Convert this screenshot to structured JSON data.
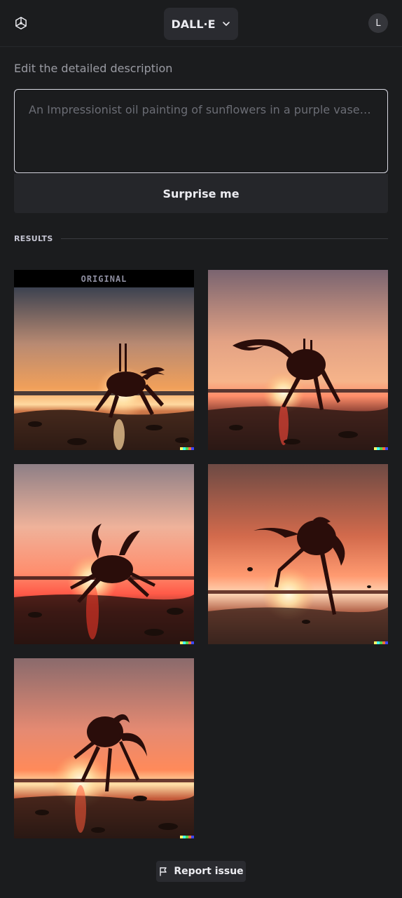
{
  "header": {
    "model_label": "DALL·E",
    "avatar_initial": "L"
  },
  "editor": {
    "section_label": "Edit the detailed description",
    "prompt_placeholder": "An Impressionist oil painting of sunflowers in a purple vase…",
    "surprise_label": "Surprise me"
  },
  "results": {
    "label": "RESULTS",
    "original_tag": "ORIGINAL",
    "images": [
      {
        "name": "result-image-original",
        "subject": "crab silhouette at sunset",
        "is_original": true
      },
      {
        "name": "result-image-2",
        "subject": "crab silhouette at sunset",
        "is_original": false
      },
      {
        "name": "result-image-3",
        "subject": "crab silhouette at sunset",
        "is_original": false
      },
      {
        "name": "result-image-4",
        "subject": "crab silhouette at sunset",
        "is_original": false
      },
      {
        "name": "result-image-5",
        "subject": "crab silhouette at sunset",
        "is_original": false
      }
    ],
    "signature_colors": [
      "#ffff66",
      "#42ffff",
      "#51da4c",
      "#ff6e3c",
      "#3c46ff"
    ]
  },
  "footer": {
    "report_label": "Report issue"
  },
  "colors": {
    "background": "#1b1c1e",
    "button_bg": "#2a2b30",
    "text_primary": "#ececf1",
    "text_muted": "#9a9ba3"
  },
  "icons": {
    "logo": "openai-logo-icon",
    "dropdown": "chevron-down-icon",
    "report": "flag-icon"
  }
}
